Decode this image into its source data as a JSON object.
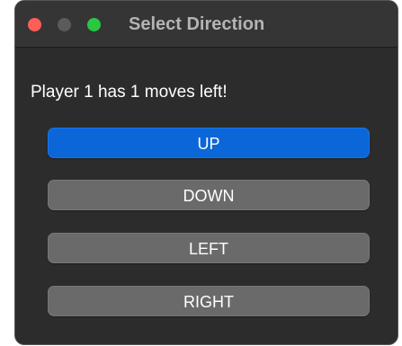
{
  "window": {
    "title": "Select Direction"
  },
  "dialog": {
    "message": "Player 1 has 1 moves left!",
    "buttons": {
      "up": "UP",
      "down": "DOWN",
      "left": "LEFT",
      "right": "RIGHT"
    },
    "default_button": "up"
  },
  "colors": {
    "window_bg": "#2c2c2c",
    "titlebar_bg": "#353535",
    "button_bg": "#6a6a6a",
    "default_button_bg": "#0b66d8",
    "close_dot": "#fe5f57",
    "minimize_dot": "#5b5b5b",
    "zoom_dot": "#28c840"
  }
}
